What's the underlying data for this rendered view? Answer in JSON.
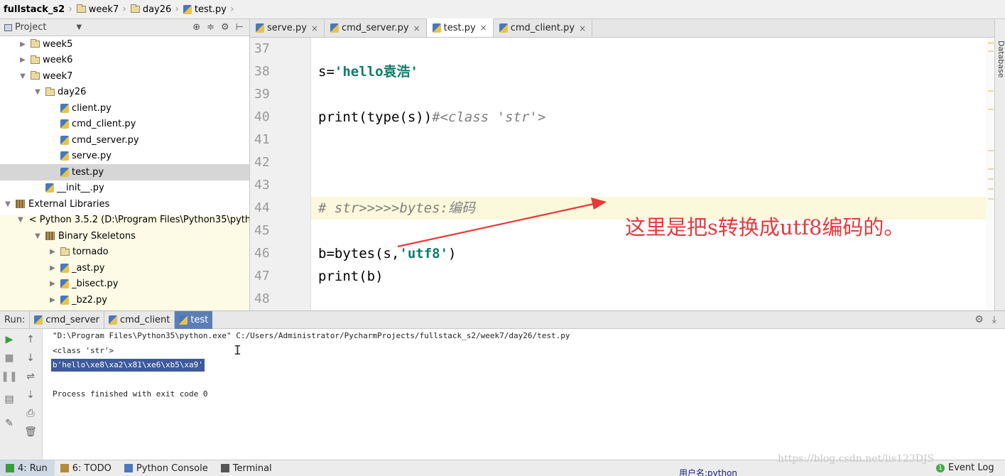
{
  "breadcrumb": [
    "fullstack_s2",
    "week7",
    "day26",
    "test.py"
  ],
  "project": {
    "title": "Project",
    "tree": [
      {
        "label": "week5",
        "icon": "folder",
        "level": 1,
        "expanded": false
      },
      {
        "label": "week6",
        "icon": "folder",
        "level": 1,
        "expanded": false
      },
      {
        "label": "week7",
        "icon": "folder",
        "level": 1,
        "expanded": true
      },
      {
        "label": "day26",
        "icon": "folder",
        "level": 2,
        "expanded": true
      },
      {
        "label": "client.py",
        "icon": "python-file",
        "level": 3
      },
      {
        "label": "cmd_client.py",
        "icon": "python-file",
        "level": 3
      },
      {
        "label": "cmd_server.py",
        "icon": "python-file",
        "level": 3
      },
      {
        "label": "serve.py",
        "icon": "python-file",
        "level": 3
      },
      {
        "label": "test.py",
        "icon": "python-file",
        "level": 3,
        "selected": true
      },
      {
        "label": "__init__.py",
        "icon": "python-file",
        "level": 2
      },
      {
        "label": "External Libraries",
        "icon": "library",
        "level": 0,
        "expanded": true
      },
      {
        "label": "< Python 3.5.2 (D:\\Program Files\\Python35\\pyth",
        "icon": "python-sdk",
        "level": 1,
        "expanded": true
      },
      {
        "label": "Binary Skeletons",
        "icon": "library",
        "level": 2,
        "expanded": true
      },
      {
        "label": "tornado",
        "icon": "folder",
        "level": 3,
        "expanded": false
      },
      {
        "label": "_ast.py",
        "icon": "python-file",
        "level": 3,
        "expanded": false
      },
      {
        "label": "_bisect.py",
        "icon": "python-file",
        "level": 3,
        "expanded": false
      },
      {
        "label": "_bz2.py",
        "icon": "python-file",
        "level": 3,
        "expanded": false
      }
    ]
  },
  "editor_tabs": [
    {
      "label": "serve.py",
      "active": false
    },
    {
      "label": "cmd_server.py",
      "active": false
    },
    {
      "label": "test.py",
      "active": true
    },
    {
      "label": "cmd_client.py",
      "active": false
    }
  ],
  "right_strip_label": "Database",
  "editor": {
    "lines": [
      {
        "no": "37",
        "tokens": []
      },
      {
        "no": "38",
        "tokens": [
          {
            "t": "s=",
            "c": ""
          },
          {
            "t": "'hello袁浩'",
            "c": "str"
          }
        ]
      },
      {
        "no": "39",
        "tokens": []
      },
      {
        "no": "40",
        "tokens": [
          {
            "t": "print(type(s))",
            "c": ""
          },
          {
            "t": "#<class 'str'>",
            "c": "cmt"
          }
        ]
      },
      {
        "no": "41",
        "tokens": []
      },
      {
        "no": "42",
        "tokens": []
      },
      {
        "no": "43",
        "tokens": []
      },
      {
        "no": "44",
        "tokens": [
          {
            "t": "# str>>>>>bytes:编码",
            "c": "cmt"
          }
        ],
        "highlight": true
      },
      {
        "no": "45",
        "tokens": []
      },
      {
        "no": "46",
        "tokens": [
          {
            "t": "b=bytes(s,",
            "c": ""
          },
          {
            "t": "'utf8'",
            "c": "str"
          },
          {
            "t": ")",
            "c": ""
          }
        ]
      },
      {
        "no": "47",
        "tokens": [
          {
            "t": "print(b)",
            "c": ""
          }
        ]
      },
      {
        "no": "48",
        "tokens": []
      }
    ]
  },
  "annotation": "这里是把s转换成utf8编码的。",
  "run": {
    "label": "Run:",
    "tabs": [
      {
        "label": "cmd_server",
        "active": false
      },
      {
        "label": "cmd_client",
        "active": false
      },
      {
        "label": "test",
        "active": true
      }
    ],
    "output": [
      {
        "text": "\"D:\\Program Files\\Python35\\python.exe\" C:/Users/Administrator/PycharmProjects/fullstack_s2/week7/day26/test.py",
        "selected": false
      },
      {
        "text": "<class 'str'>",
        "selected": false
      },
      {
        "text": "b'hello\\xe8\\xa2\\x81\\xe6\\xb5\\xa9'",
        "selected": true
      },
      {
        "text": "",
        "selected": false
      },
      {
        "text": "Process finished with exit code 0",
        "selected": false
      }
    ]
  },
  "bottom_bar": {
    "items": [
      {
        "label": "4: Run",
        "icon": "run-icon",
        "active": true
      },
      {
        "label": "6: TODO",
        "icon": "todo-icon",
        "active": false
      },
      {
        "label": "Python Console",
        "icon": "python-console-icon",
        "active": false
      },
      {
        "label": "Terminal",
        "icon": "terminal-icon",
        "active": false
      }
    ],
    "status_user": "用户名:python",
    "event_log": "Event Log",
    "event_count": "1"
  },
  "watermark": "https://blog.csdn.net/lis123DJS",
  "colors": {
    "string": "#0e7c6b",
    "comment": "#808080",
    "annotation": "#e83838",
    "selection": "#3c5a9c"
  }
}
